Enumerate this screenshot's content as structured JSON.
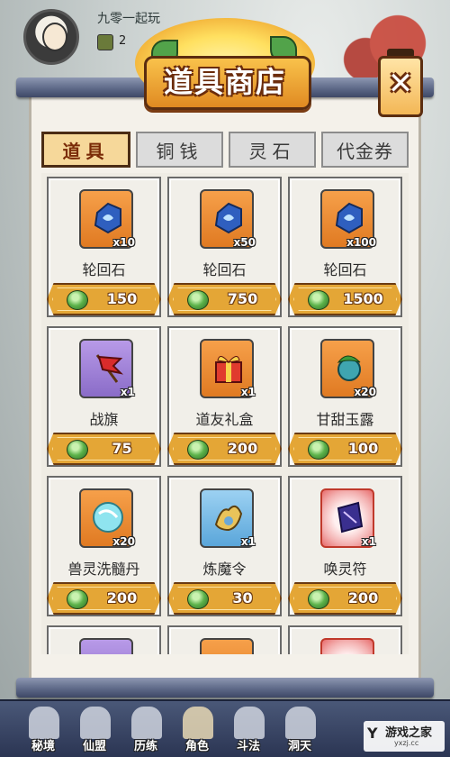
{
  "player": {
    "name": "九零一起玩",
    "coins": "2"
  },
  "shop": {
    "title": "道具商店",
    "close_label": "✕"
  },
  "tabs": [
    {
      "label": "道具",
      "active": true
    },
    {
      "label": "铜钱",
      "active": false
    },
    {
      "label": "灵石",
      "active": false
    },
    {
      "label": "代金券",
      "active": false
    }
  ],
  "items": [
    {
      "name": "轮回石",
      "qty": "x10",
      "price": "150",
      "bg": "orange",
      "icon": "stone-icon"
    },
    {
      "name": "轮回石",
      "qty": "x50",
      "price": "750",
      "bg": "orange",
      "icon": "stone-icon"
    },
    {
      "name": "轮回石",
      "qty": "x100",
      "price": "1500",
      "bg": "orange",
      "icon": "stone-icon"
    },
    {
      "name": "战旗",
      "qty": "x1",
      "price": "75",
      "bg": "purple",
      "icon": "banner-icon"
    },
    {
      "name": "道友礼盒",
      "qty": "x1",
      "price": "200",
      "bg": "orange",
      "icon": "gift-box-icon"
    },
    {
      "name": "甘甜玉露",
      "qty": "x20",
      "price": "100",
      "bg": "orange",
      "icon": "dew-icon"
    },
    {
      "name": "兽灵洗髓丹",
      "qty": "x20",
      "price": "200",
      "bg": "orange",
      "icon": "pill-icon"
    },
    {
      "name": "炼魔令",
      "qty": "x1",
      "price": "30",
      "bg": "blue",
      "icon": "token-icon"
    },
    {
      "name": "唤灵符",
      "qty": "x1",
      "price": "200",
      "bg": "red",
      "icon": "talisman-icon"
    }
  ],
  "partial_items": [
    {
      "bg": "purple"
    },
    {
      "bg": "orange"
    },
    {
      "bg": "red"
    }
  ],
  "bottom_nav": [
    {
      "label": "秘境",
      "active": false
    },
    {
      "label": "仙盟",
      "active": false
    },
    {
      "label": "历练",
      "active": false
    },
    {
      "label": "角色",
      "active": true
    },
    {
      "label": "斗法",
      "active": false
    },
    {
      "label": "洞天",
      "active": false
    }
  ],
  "watermark": {
    "logo": "Y",
    "text": "游戏之家",
    "sub": "yxzj.cc"
  },
  "colors": {
    "price_bar": "#e4a636",
    "tab_active": "#f6d89a",
    "nav_bg": "#2b3553"
  }
}
